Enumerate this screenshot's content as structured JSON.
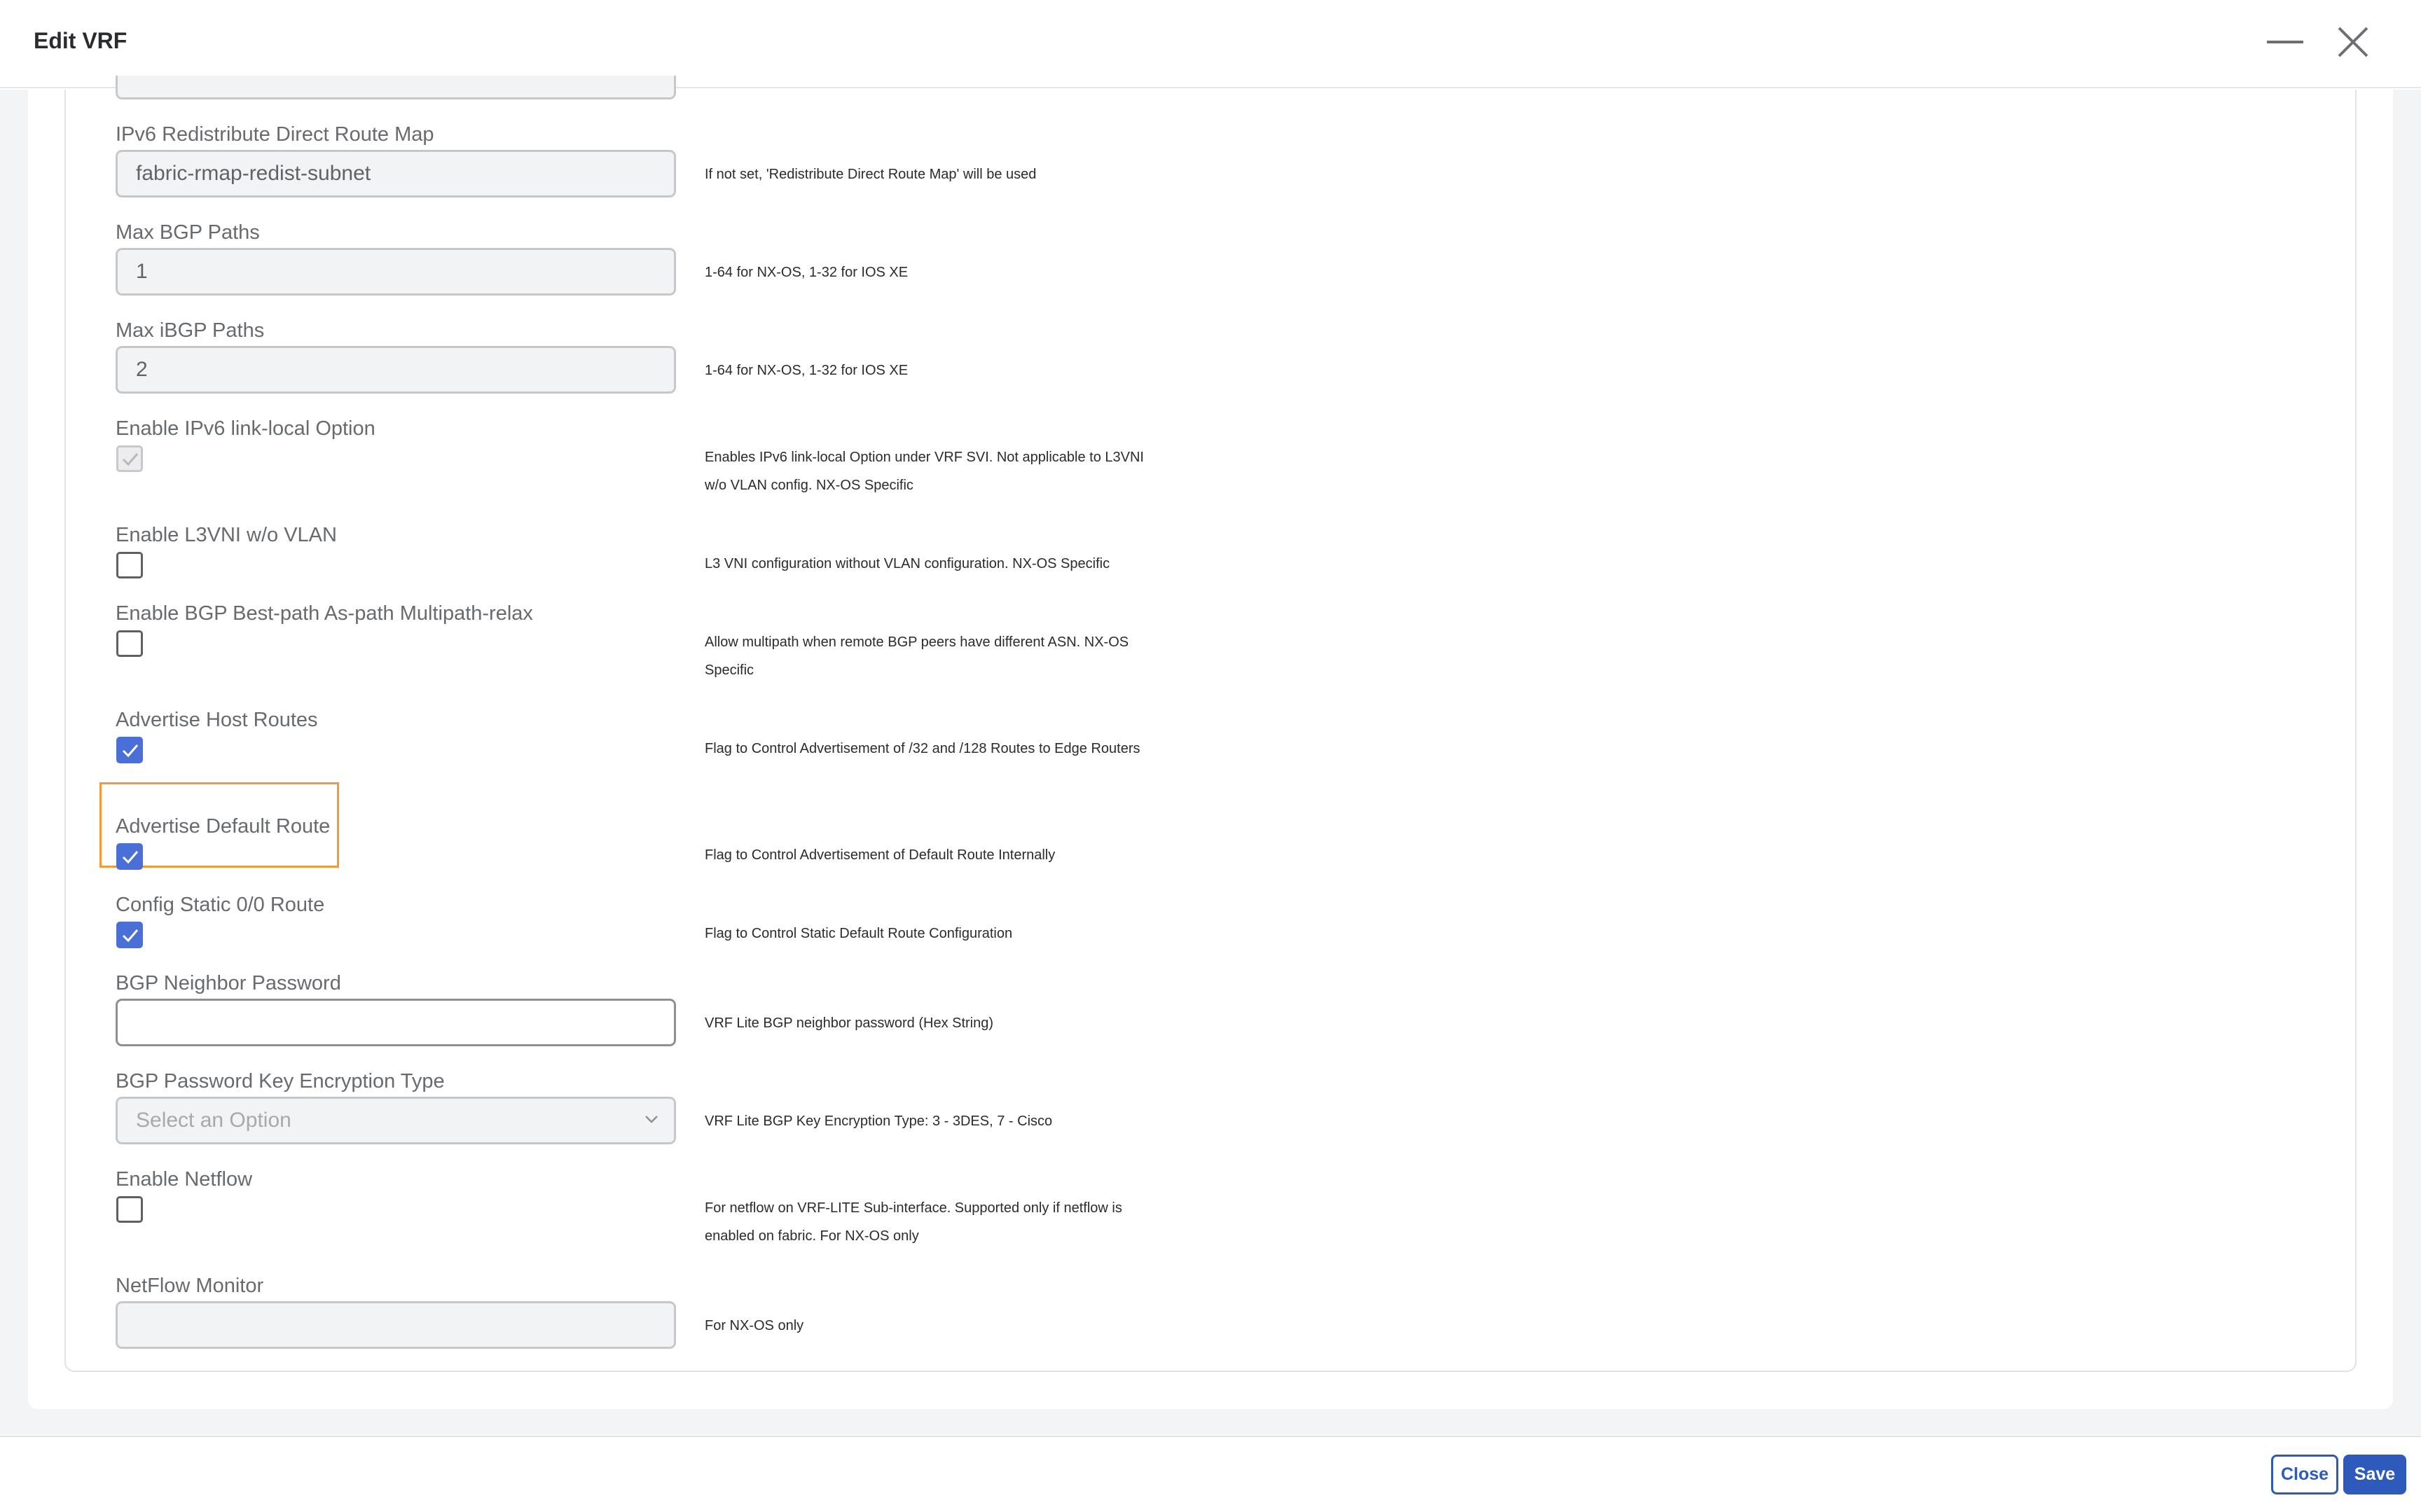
{
  "dialog": {
    "title": "Edit VRF"
  },
  "fields": {
    "ipv6_redist_label": "IPv6 Redistribute Direct Route Map",
    "ipv6_redist_value": "fabric-rmap-redist-subnet",
    "ipv6_redist_help": "If not set, 'Redistribute Direct Route Map' will be used",
    "max_bgp_label": "Max BGP Paths",
    "max_bgp_value": "1",
    "max_bgp_help": "1-64 for NX-OS, 1-32 for IOS XE",
    "max_ibgp_label": "Max iBGP Paths",
    "max_ibgp_value": "2",
    "max_ibgp_help": "1-64 for NX-OS, 1-32 for IOS XE",
    "ipv6_linklocal_label": "Enable IPv6 link-local Option",
    "ipv6_linklocal_help": "Enables IPv6 link-local Option under VRF SVI. Not applicable to L3VNI w/o VLAN config. NX-OS Specific",
    "l3vni_label": "Enable L3VNI w/o VLAN",
    "l3vni_help": "L3 VNI configuration without VLAN configuration. NX-OS Specific",
    "bestpath_label": "Enable BGP Best-path As-path Multipath-relax",
    "bestpath_help": "Allow multipath when remote BGP peers have different ASN. NX-OS Specific",
    "adv_host_label": "Advertise Host Routes",
    "adv_host_help": "Flag to Control Advertisement of /32 and /128 Routes to Edge Routers",
    "adv_default_label": "Advertise Default Route",
    "adv_default_help": "Flag to Control Advertisement of Default Route Internally",
    "static_label": "Config Static 0/0 Route",
    "static_help": "Flag to Control Static Default Route Configuration",
    "bgp_pw_label": "BGP Neighbor Password",
    "bgp_pw_value": "",
    "bgp_pw_help": "VRF Lite BGP neighbor password (Hex String)",
    "bgp_enc_label": "BGP Password Key Encryption Type",
    "bgp_enc_placeholder": "Select an Option",
    "bgp_enc_help": "VRF Lite BGP Key Encryption Type: 3 - 3DES, 7 - Cisco",
    "netflow_label": "Enable Netflow",
    "netflow_help": "For netflow on VRF-LITE Sub-interface. Supported only if netflow is enabled on fabric. For NX-OS only",
    "nf_monitor_label": "NetFlow Monitor",
    "nf_monitor_value": "",
    "nf_monitor_help": "For NX-OS only"
  },
  "checkbox_state": {
    "ipv6_linklocal": "checked-disabled",
    "l3vni": "unchecked",
    "bestpath": "unchecked",
    "adv_host": "checked",
    "adv_default": "checked",
    "static": "checked",
    "netflow": "unchecked"
  },
  "footer": {
    "close_label": "Close",
    "save_label": "Save"
  },
  "colors": {
    "accent": "#2e5bbb",
    "checkbox": "#4a6fd6",
    "highlight": "#f19a3a"
  }
}
